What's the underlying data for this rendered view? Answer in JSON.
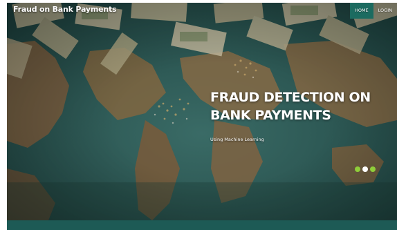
{
  "navbar": {
    "brand": "Fraud on Bank Payments",
    "links": [
      {
        "label": "HOME",
        "active": true
      },
      {
        "label": "LOGIN",
        "active": false
      }
    ]
  },
  "hero": {
    "title_line1": "FRAUD DETECTION ON",
    "title_line2": "BANK PAYMENTS",
    "subtitle": "Using Machine Learning",
    "slide_count": 3,
    "active_slide": 2
  },
  "colors": {
    "nav_active": "#1c6b60",
    "dot_inactive": "#8fce3a",
    "dot_active": "#ffffff",
    "footer_band": "#1d5a55",
    "map_ocean": "#2c5552",
    "map_land": "#8a6a45"
  }
}
